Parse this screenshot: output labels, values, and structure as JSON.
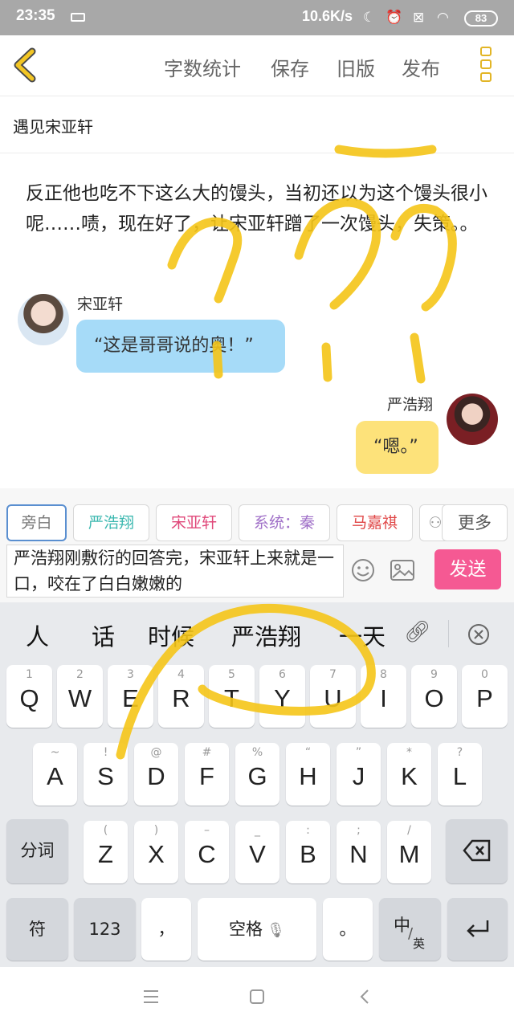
{
  "status_bar": {
    "time": "23:35",
    "net_speed": "10.6K/s",
    "battery": "83"
  },
  "header": {
    "nav": [
      "字数统计",
      "保存",
      "旧版",
      "发布"
    ]
  },
  "story_title": "遇见宋亚轩",
  "narration": "反正他也吃不下这么大的馒头，当初还以为这个馒头很小呢……啧，现在好了，让宋亚轩蹭了一次馒头，失策。。",
  "messages": [
    {
      "speaker": "宋亚轩",
      "text": "“这是哥哥说的奥！”"
    },
    {
      "speaker": "严浩翔",
      "text": "“嗯。”"
    }
  ],
  "roles": [
    {
      "label": "旁白",
      "color": "#777777"
    },
    {
      "label": "严浩翔",
      "color": "#3cb8b0"
    },
    {
      "label": "宋亚轩",
      "color": "#e0487a"
    },
    {
      "label": "系统：秦",
      "color": "#a070c8"
    },
    {
      "label": "马嘉祺",
      "color": "#e04848"
    }
  ],
  "more_label": "更多",
  "input_text": "严浩翔刚敷衍的回答完，宋亚轩上来就是一口，咬在了白白嫩嫩的",
  "send_label": "发送",
  "candidates": [
    "人",
    "话",
    "时候",
    "严浩翔",
    "一天"
  ],
  "keyboard": {
    "row1": [
      {
        "main": "Q",
        "hint": "1"
      },
      {
        "main": "W",
        "hint": "2"
      },
      {
        "main": "E",
        "hint": "3"
      },
      {
        "main": "R",
        "hint": "4"
      },
      {
        "main": "T",
        "hint": "5"
      },
      {
        "main": "Y",
        "hint": "6"
      },
      {
        "main": "U",
        "hint": "7"
      },
      {
        "main": "I",
        "hint": "8"
      },
      {
        "main": "O",
        "hint": "9"
      },
      {
        "main": "P",
        "hint": "0"
      }
    ],
    "row2": [
      {
        "main": "A",
        "hint": "~"
      },
      {
        "main": "S",
        "hint": "!"
      },
      {
        "main": "D",
        "hint": "@"
      },
      {
        "main": "F",
        "hint": "#"
      },
      {
        "main": "G",
        "hint": "%"
      },
      {
        "main": "H",
        "hint": "“"
      },
      {
        "main": "J",
        "hint": "”"
      },
      {
        "main": "K",
        "hint": "*"
      },
      {
        "main": "L",
        "hint": "?"
      }
    ],
    "row3": [
      {
        "main": "Z",
        "hint": "("
      },
      {
        "main": "X",
        "hint": ")"
      },
      {
        "main": "C",
        "hint": "–"
      },
      {
        "main": "V",
        "hint": "_"
      },
      {
        "main": "B",
        "hint": ":"
      },
      {
        "main": "N",
        "hint": ";"
      },
      {
        "main": "M",
        "hint": "/"
      }
    ],
    "segment_label": "分词",
    "symbol_label": "符",
    "number_label": "123",
    "comma": "，",
    "space_label": "空格",
    "period": "。",
    "lang_main": "中",
    "lang_sub": "英"
  },
  "colors": {
    "accent_yellow": "#f5c518",
    "send_pink": "#f55993",
    "bubble_blue": "#a6dbf8",
    "bubble_yellow": "#fde27a"
  }
}
